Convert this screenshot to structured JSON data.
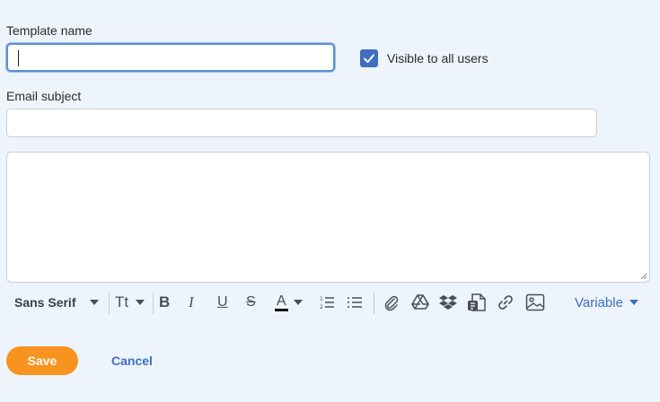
{
  "form": {
    "template_name_label": "Template name",
    "template_name_value": "",
    "visible_label": "Visible to all users",
    "visible_checked": true,
    "email_subject_label": "Email subject",
    "email_subject_value": "",
    "body_value": ""
  },
  "toolbar": {
    "font_family": "Sans Serif",
    "font_size_label": "Tt",
    "bold_label": "B",
    "italic_label": "I",
    "underline_label": "U",
    "strike_label": "S",
    "text_color_label": "A",
    "variable_label": "Variable"
  },
  "actions": {
    "save_label": "Save",
    "cancel_label": "Cancel"
  },
  "colors": {
    "accent": "#3e6fbe",
    "save": "#f7931e",
    "background": "#eef4fb"
  }
}
